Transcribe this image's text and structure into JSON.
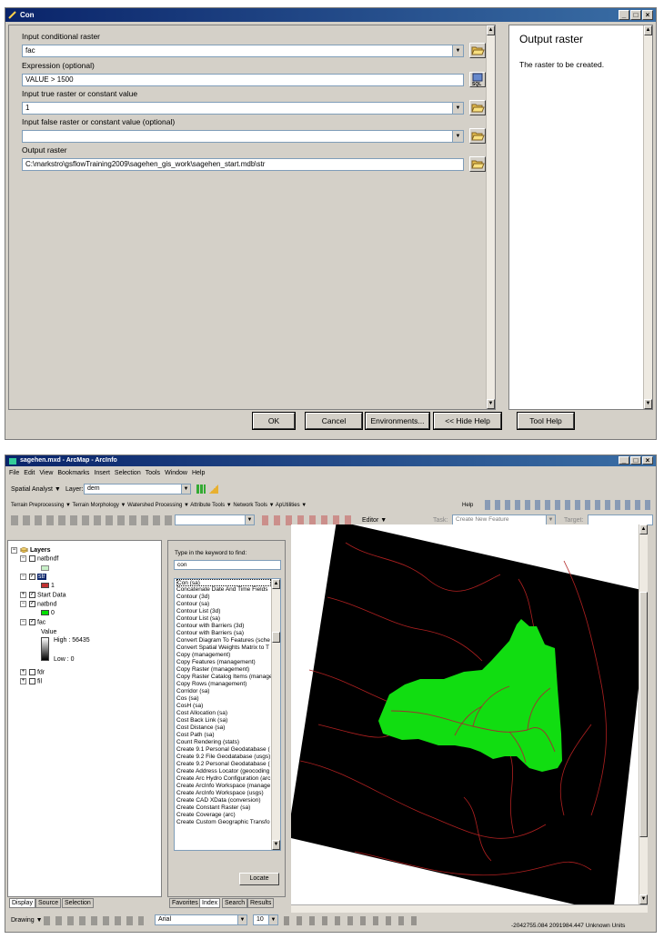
{
  "dialog": {
    "title": "Con",
    "win_buttons": [
      "_",
      "□",
      "×"
    ],
    "fields": [
      {
        "label": "Input conditional raster",
        "value": "fac",
        "dropdown": true,
        "icon": "folder-open-icon"
      },
      {
        "label": "Expression (optional)",
        "value": "VALUE > 1500",
        "dropdown": false,
        "icon": "sql-icon"
      },
      {
        "label": "Input true raster or constant value",
        "value": "1",
        "dropdown": true,
        "icon": "folder-open-icon"
      },
      {
        "label": "Input false raster or constant value (optional)",
        "value": "",
        "dropdown": true,
        "icon": "folder-open-icon"
      },
      {
        "label": "Output raster",
        "value": "C:\\markstro\\gsflowTraining2009\\sagehen_gis_work\\sagehen_start.mdb\\str",
        "dropdown": false,
        "icon": "folder-open-icon"
      }
    ],
    "help_title": "Output raster",
    "help_text": "The raster to be created.",
    "buttons": {
      "ok": "OK",
      "cancel": "Cancel",
      "environments": "Environments...",
      "hide_help": "<< Hide Help",
      "tool_help": "Tool Help"
    }
  },
  "arcmap": {
    "title": "sagehen.mxd - ArcMap - ArcInfo",
    "menu": [
      "File",
      "Edit",
      "View",
      "Bookmarks",
      "Insert",
      "Selection",
      "Tools",
      "Window",
      "Help"
    ],
    "spatial_analyst": "Spatial Analyst ▼",
    "layer_label": "Layer:",
    "layer_value": "dem",
    "toolbar3": "Terrain Preprocessing ▼  Terrain Morphology ▼  Watershed Processing ▼  Attribute Tools ▼  Network Tools ▼  ApUtilities ▼",
    "help_item": "Help",
    "editor": "Editor ▼",
    "task_label": "Task:",
    "task_value": "Create New Feature",
    "target_label": "Target:",
    "toc": {
      "root": "Layers",
      "items": [
        {
          "name": "natbndf",
          "checked": false
        },
        {
          "name": "str",
          "checked": true
        },
        {
          "name": "1",
          "legend": true,
          "color": "#c03030"
        },
        {
          "name": "Start Data",
          "checked": true
        },
        {
          "name": "natbnd",
          "checked": true
        },
        {
          "name": "0",
          "legend": true,
          "color": "#00e000"
        },
        {
          "name": "fac",
          "checked": true
        },
        {
          "name": "Value"
        },
        {
          "name": "High : 56435"
        },
        {
          "name": "Low : 0"
        },
        {
          "name": "fdr",
          "checked": false
        },
        {
          "name": "fil",
          "checked": false
        }
      ],
      "tabs": [
        "Display",
        "Source",
        "Selection"
      ]
    },
    "index": {
      "prompt": "Type in the keyword to find:",
      "keyword": "con",
      "items": [
        "Con (sa)",
        "Concatenate Date And Time Fields",
        "Contour (3d)",
        "Contour (sa)",
        "Contour List (3d)",
        "Contour List (sa)",
        "Contour with Barriers (3d)",
        "Contour with Barriers (sa)",
        "Convert Diagram To Features (sche",
        "Convert Spatial Weights Matrix to T",
        "Copy (management)",
        "Copy Features (management)",
        "Copy Raster (management)",
        "Copy Raster Catalog Items (manage",
        "Copy Rows (management)",
        "Corridor (sa)",
        "Cos (sa)",
        "CosH (sa)",
        "Cost Allocation (sa)",
        "Cost Back Link (sa)",
        "Cost Distance (sa)",
        "Cost Path (sa)",
        "Count Rendering (stats)",
        "Create 9.1 Personal Geodatabase (",
        "Create 9.2 File Geodatabase (usgs)",
        "Create 9.2 Personal Geodatabase (",
        "Create Address Locator (geocoding",
        "Create Arc Hydro Configuration (arc",
        "Create ArcInfo Workspace (manage",
        "Create ArcInfo Workspace (usgs)",
        "Create CAD XData (conversion)",
        "Create Constant Raster (sa)",
        "Create Coverage (arc)",
        "Create Custom Geographic Transfo"
      ],
      "locate": "Locate",
      "tabs": [
        "Favorites",
        "Index",
        "Search",
        "Results"
      ]
    },
    "drawing": "Drawing ▼",
    "font": "Arial",
    "font_size": "10",
    "status": "-2042755.084  2091984.447 Unknown Units"
  }
}
